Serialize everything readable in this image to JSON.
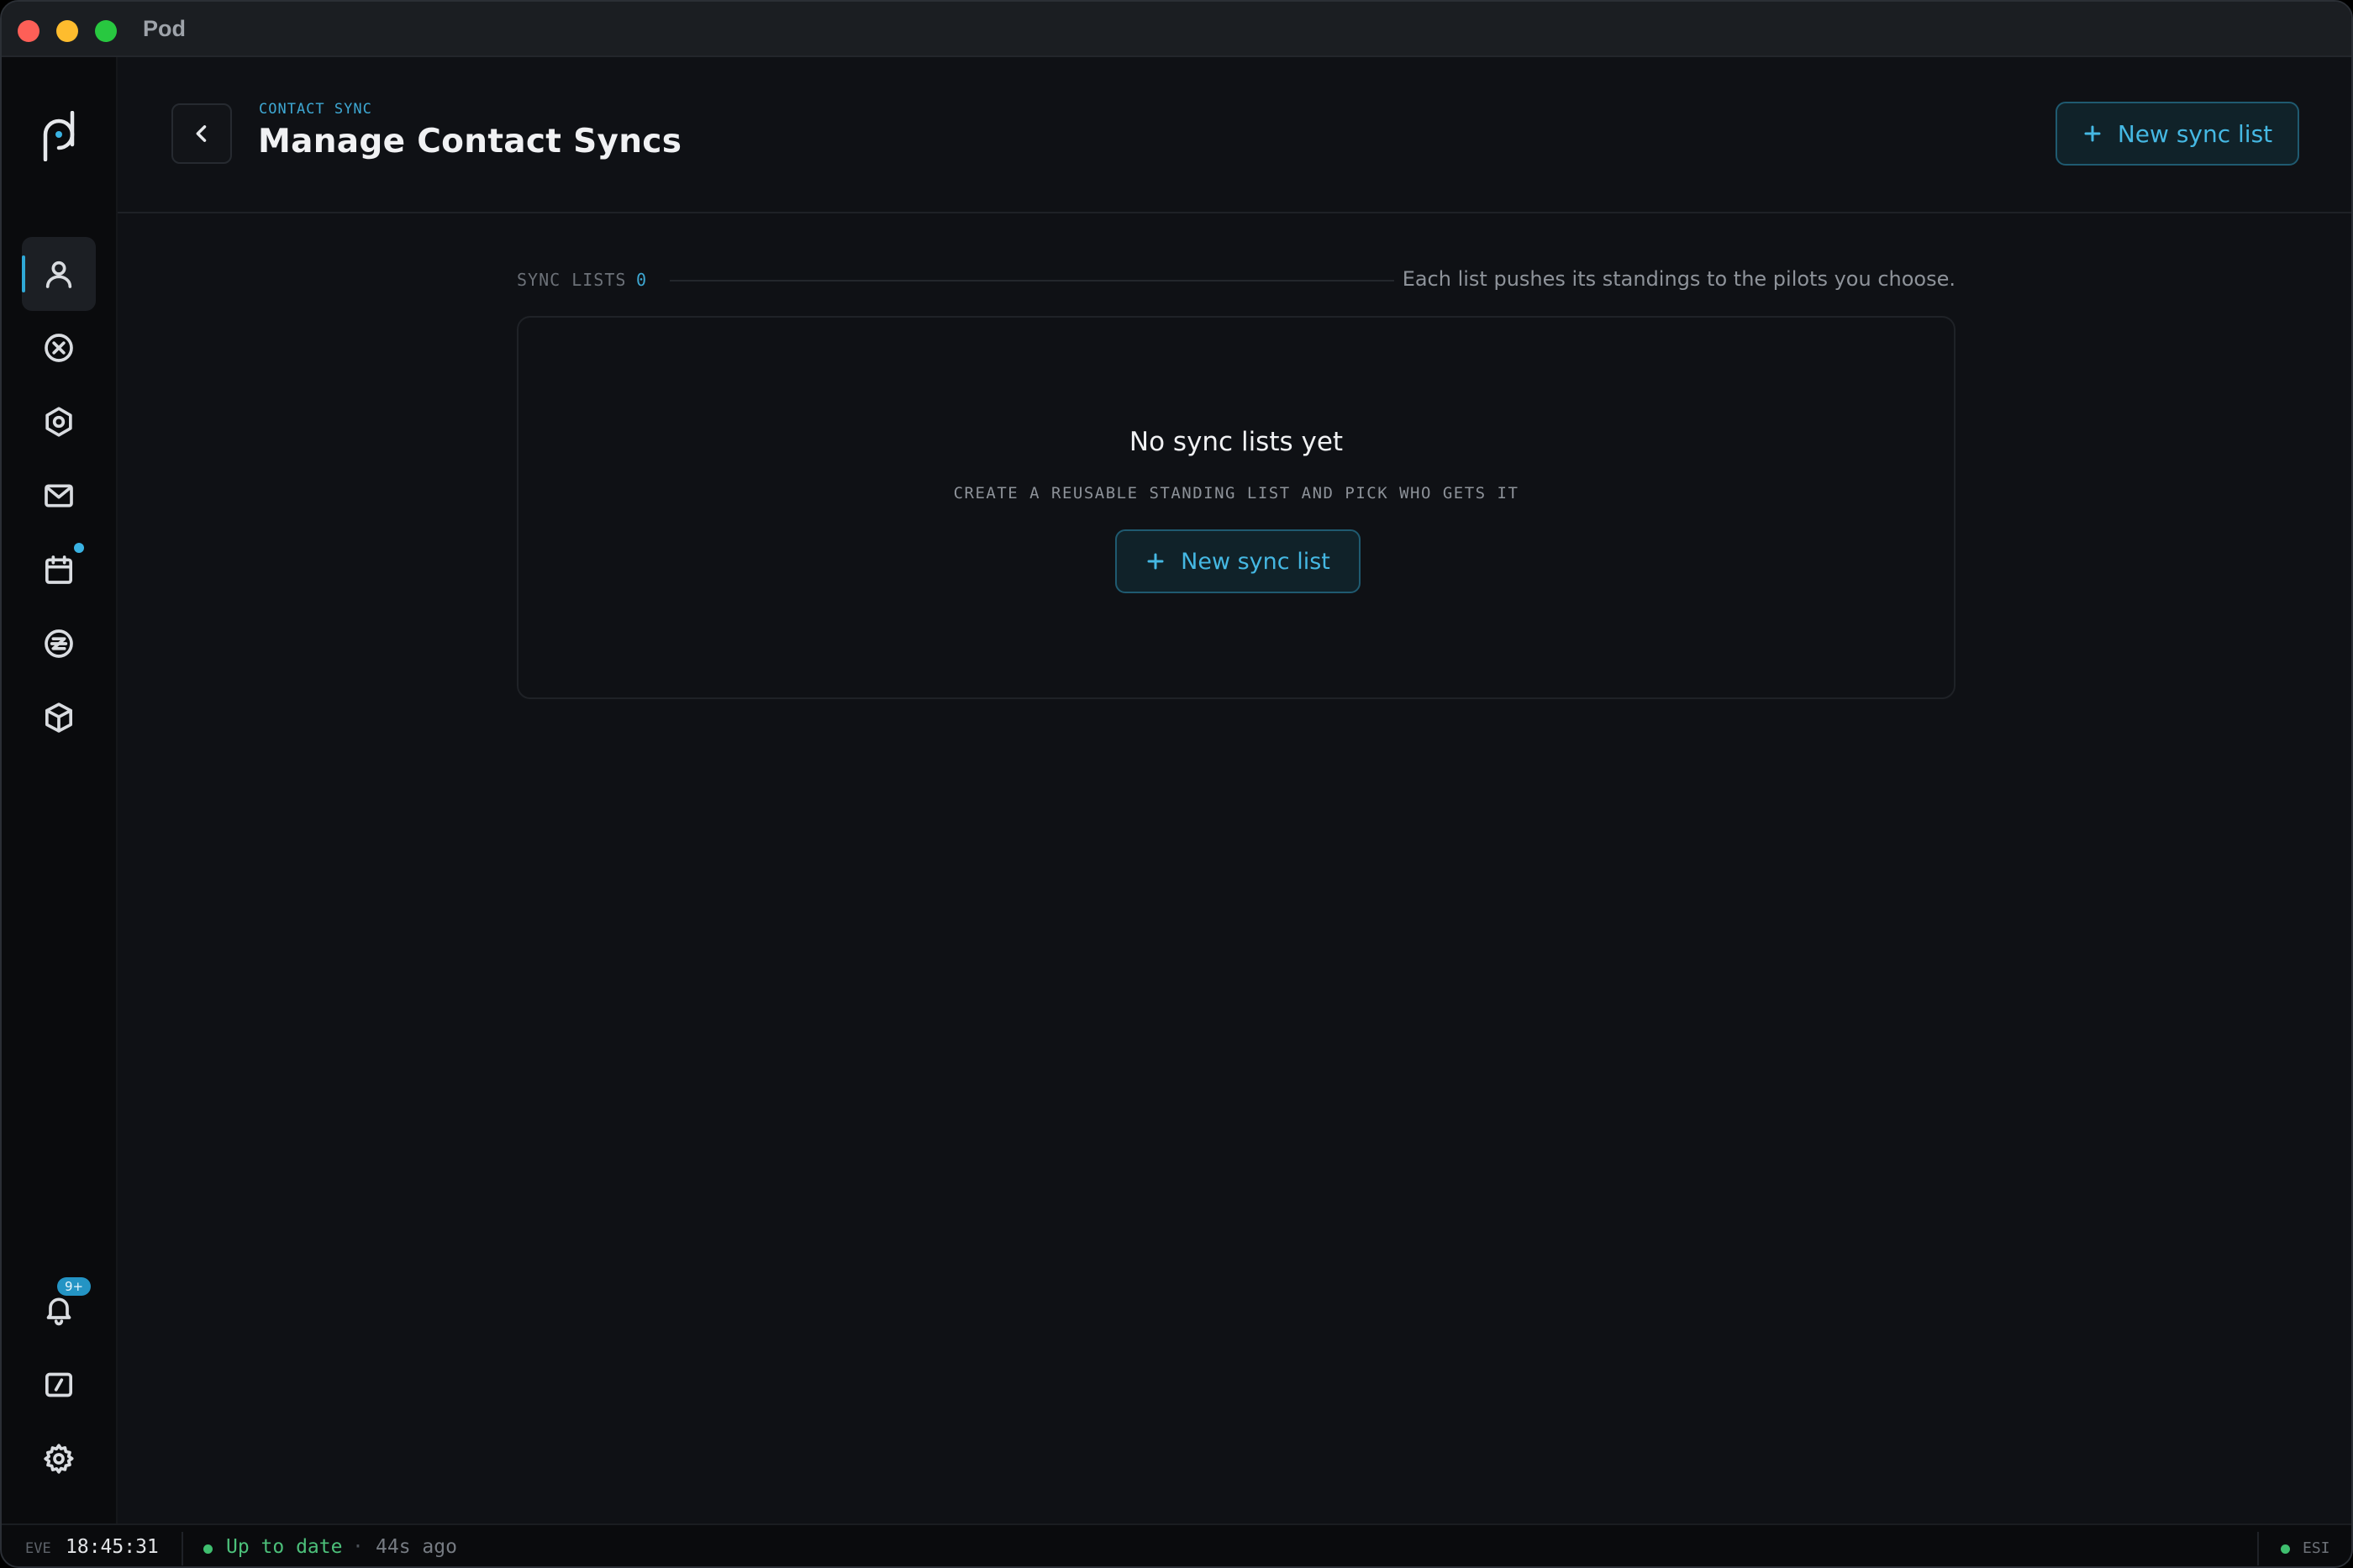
{
  "window": {
    "title": "Pod"
  },
  "sidebar": {
    "items": [
      {
        "name": "contacts",
        "icon": "user-icon",
        "active": true
      },
      {
        "name": "blocked",
        "icon": "circle-x-icon",
        "active": false
      },
      {
        "name": "modules",
        "icon": "hexagon-icon",
        "active": false
      },
      {
        "name": "mail",
        "icon": "mail-icon",
        "active": false
      },
      {
        "name": "calendar",
        "icon": "calendar-icon",
        "active": false,
        "has_dot": true
      },
      {
        "name": "currency",
        "icon": "circle-z-icon",
        "active": false
      },
      {
        "name": "assets",
        "icon": "box-icon",
        "active": false
      }
    ],
    "bottom": {
      "notifications": {
        "icon": "bell-icon",
        "badge": "9+"
      },
      "console": {
        "icon": "terminal-slash-icon"
      },
      "settings": {
        "icon": "gear-icon"
      }
    }
  },
  "header": {
    "eyebrow": "CONTACT SYNC",
    "title": "Manage Contact Syncs",
    "new_button_label": "New sync list"
  },
  "section": {
    "label": "SYNC LISTS",
    "count": "0",
    "hint": "Each list pushes its standings to the pilots you choose."
  },
  "empty_state": {
    "title": "No sync lists yet",
    "subtitle": "CREATE A REUSABLE STANDING LIST AND PICK WHO GETS IT",
    "button_label": "New sync list"
  },
  "status_bar": {
    "eve_label": "EVE",
    "time": "18:45:31",
    "status": "Up to date",
    "separator": "·",
    "ago": "44s ago",
    "esi_label": "ESI"
  },
  "colors": {
    "accent": "#3ea8d3",
    "background": "#0f1115",
    "sidebar": "#0a0b0d",
    "status_ok": "#4cc07a"
  }
}
